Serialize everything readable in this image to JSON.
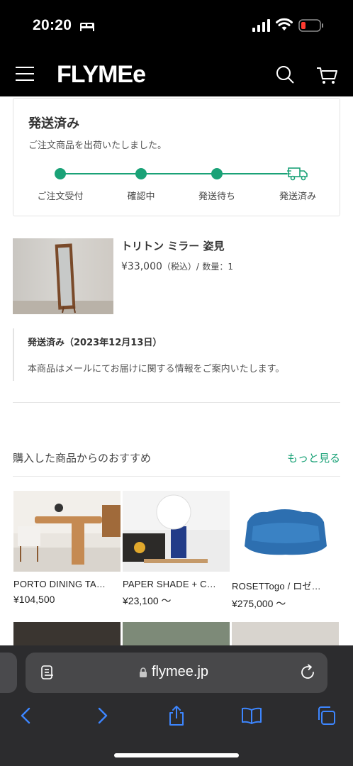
{
  "status_bar": {
    "time": "20:20"
  },
  "header": {
    "logo": "FLYMEe"
  },
  "order_status": {
    "title": "発送済み",
    "description": "ご注文商品を出荷いたしました。",
    "steps": [
      "ご注文受付",
      "確認中",
      "発送待ち",
      "発送済み"
    ]
  },
  "product": {
    "name": "トリトン ミラー 姿見",
    "price": "¥33,000",
    "tax_label": "（税込）/",
    "quantity_label": "数量：1"
  },
  "shipping_notice": {
    "title": "発送済み（2023年12月13日）",
    "body": "本商品はメールにてお届けに関する情報をご案内いたします。"
  },
  "recommendations": {
    "heading": "購入した商品からのおすすめ",
    "more_label": "もっと見る",
    "items": [
      {
        "name": "PORTO DINING TA…",
        "price": "¥104,500"
      },
      {
        "name": "PAPER SHADE + C…",
        "price": "¥23,100 〜"
      },
      {
        "name": "ROSETTogo / ロゼ…",
        "price": "¥275,000 〜"
      }
    ]
  },
  "browser": {
    "url": "flymee.jp"
  },
  "colors": {
    "accent": "#1aa277",
    "header_bg": "#000000",
    "browser_bg": "#2c2c2e",
    "browser_icon": "#3d86ff"
  }
}
